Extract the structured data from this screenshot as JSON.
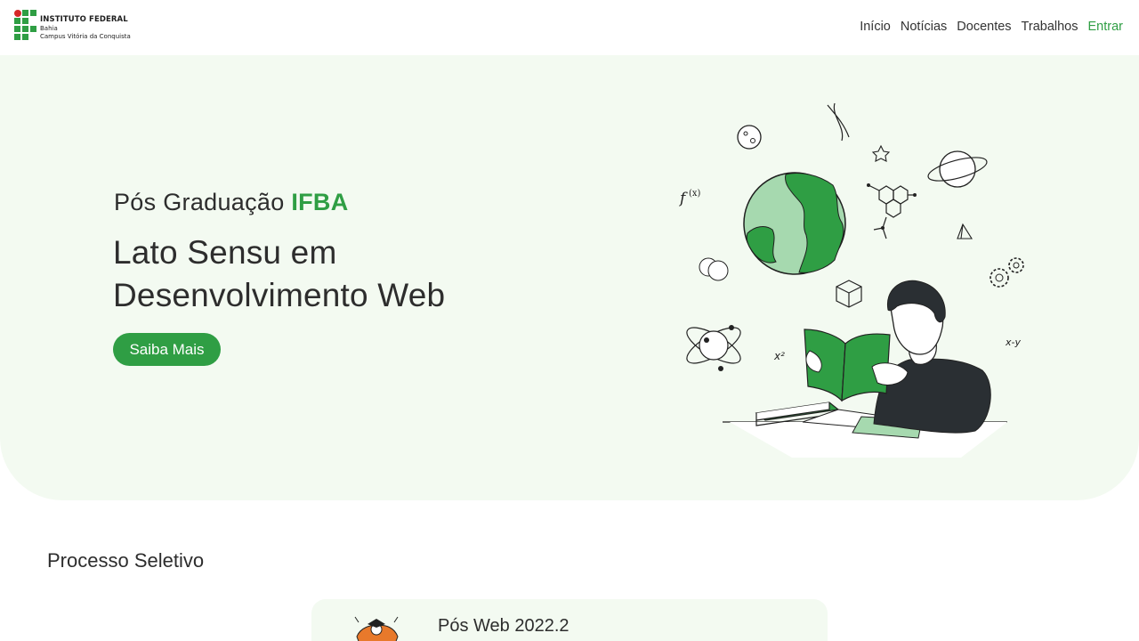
{
  "header": {
    "logo": {
      "title": "INSTITUTO FEDERAL",
      "line1": "Bahia",
      "line2": "Campus Vitória da Conquista"
    },
    "nav": [
      {
        "label": "Início"
      },
      {
        "label": "Notícias"
      },
      {
        "label": "Docentes"
      },
      {
        "label": "Trabalhos"
      },
      {
        "label": "Entrar"
      }
    ]
  },
  "hero": {
    "pretitle": "Pós Graduação ",
    "pretitle_accent": "IFBA",
    "title": "Lato Sensu em Desenvolvimento Web",
    "button_label": "Saiba Mais",
    "illustration_icon": "student-reading-illustration"
  },
  "selection": {
    "title": "Processo Seletivo",
    "cards": [
      {
        "title": "Pós Web 2022.2",
        "icon": "graduation-illustration"
      }
    ]
  },
  "colors": {
    "accent": "#2f9e44",
    "hero_bg": "#f3faf1",
    "text": "#2d2d2d",
    "logo_red": "#d62828"
  }
}
